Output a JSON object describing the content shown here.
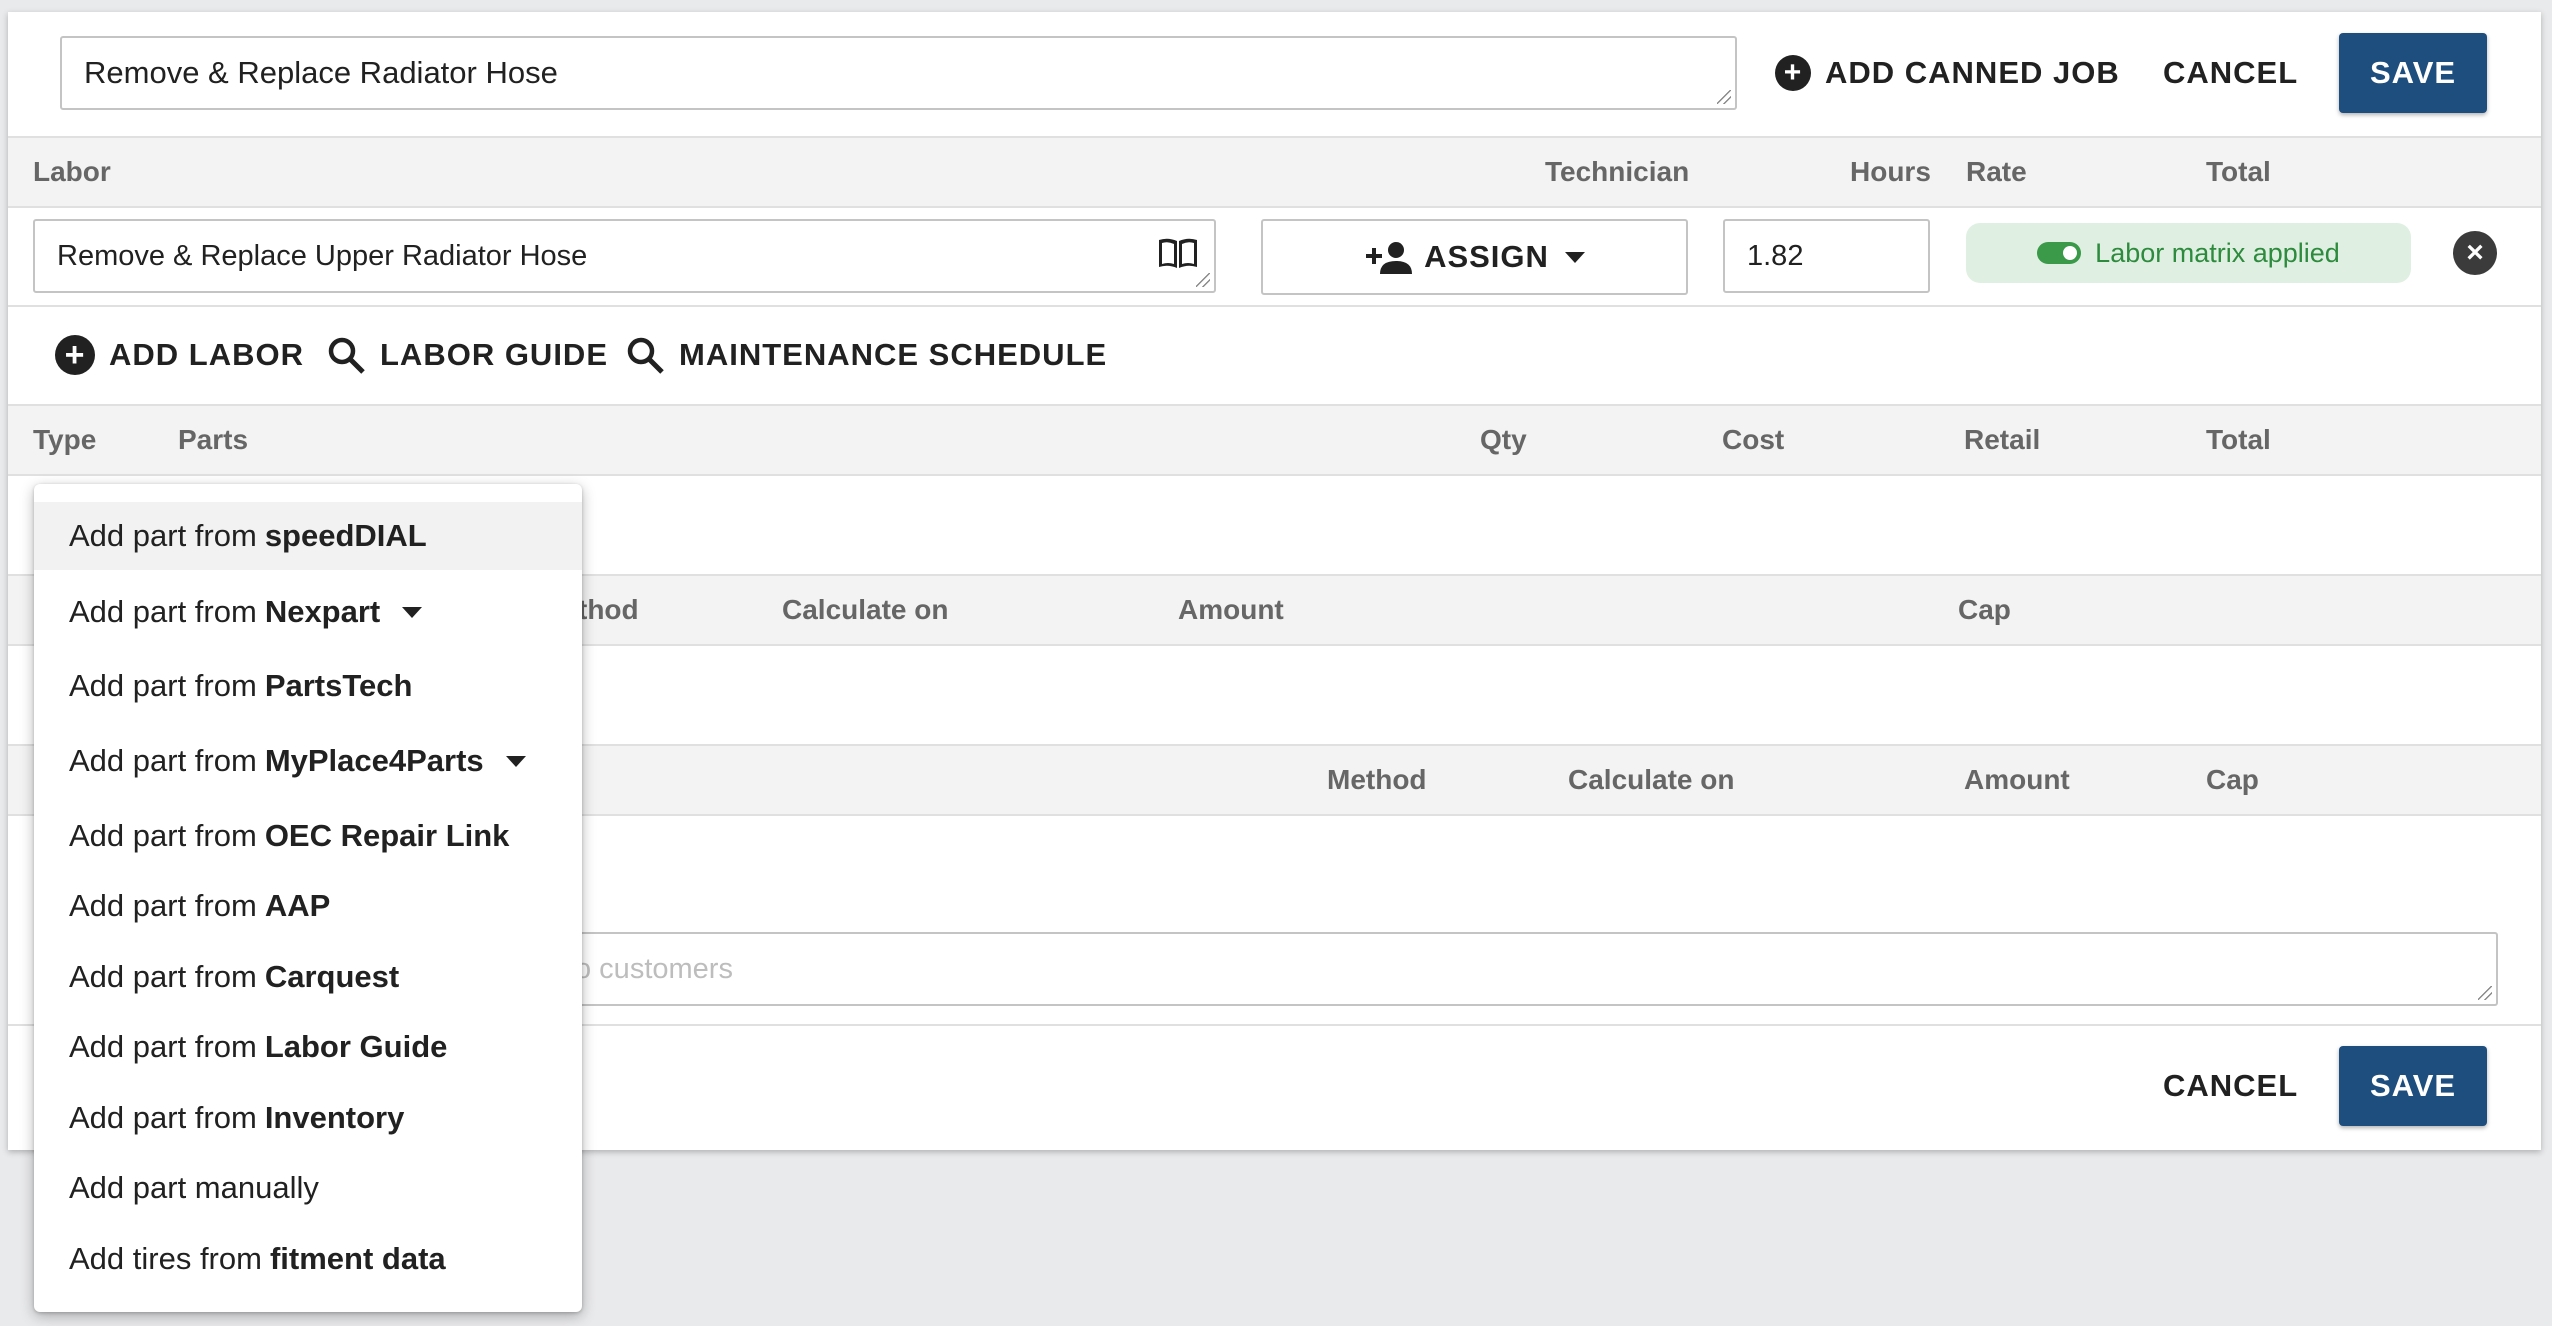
{
  "job": {
    "title_value": "Remove & Replace Radiator Hose",
    "add_canned_job_label": "ADD CANNED JOB",
    "cancel_label": "CANCEL",
    "save_label": "SAVE"
  },
  "labor_header": {
    "labor": "Labor",
    "technician": "Technician",
    "hours": "Hours",
    "rate": "Rate",
    "total": "Total"
  },
  "labor_row": {
    "description_value": "Remove & Replace Upper Radiator Hose",
    "assign_label": "ASSIGN",
    "hours_value": "1.82",
    "matrix_label": "Labor matrix applied"
  },
  "labor_actions": {
    "add_labor": "ADD LABOR",
    "labor_guide": "LABOR GUIDE",
    "maintenance_schedule": "MAINTENANCE SCHEDULE"
  },
  "parts_header": {
    "type": "Type",
    "parts": "Parts",
    "qty": "Qty",
    "cost": "Cost",
    "retail": "Retail",
    "total": "Total"
  },
  "fees_header": {
    "method_partial": "thod",
    "calculate_on": "Calculate on",
    "amount": "Amount",
    "cap": "Cap"
  },
  "discounts_header": {
    "method": "Method",
    "calculate_on": "Calculate on",
    "amount": "Amount",
    "cap": "Cap"
  },
  "notes": {
    "placeholder_partial": "o customers"
  },
  "footer": {
    "cancel_label": "CANCEL",
    "save_label": "SAVE"
  },
  "menu": {
    "prefix": "Add part from",
    "items": [
      {
        "prefix": "Add part from",
        "source": "speedDIAL"
      },
      {
        "prefix": "Add part from",
        "source": "Nexpart"
      },
      {
        "prefix": "Add part from",
        "source": "PartsTech"
      },
      {
        "prefix": "Add part from",
        "source": "MyPlace4Parts"
      },
      {
        "prefix": "Add part from",
        "source": "OEC Repair Link"
      },
      {
        "prefix": "Add part from",
        "source": "AAP"
      },
      {
        "prefix": "Add part from",
        "source": "Carquest"
      },
      {
        "prefix": "Add part from",
        "source": "Labor Guide"
      },
      {
        "prefix": "Add part from",
        "source": "Inventory"
      },
      {
        "prefix": "Add part manually",
        "source": ""
      },
      {
        "prefix": "Add tires from",
        "source": "fitment data"
      }
    ]
  },
  "colors": {
    "primary": "#1d4e7e",
    "matrix_bg": "#dff0e2",
    "matrix_text": "#2e8b3e",
    "header_bg": "#f3f3f3",
    "page_bg": "#e9eaec"
  }
}
